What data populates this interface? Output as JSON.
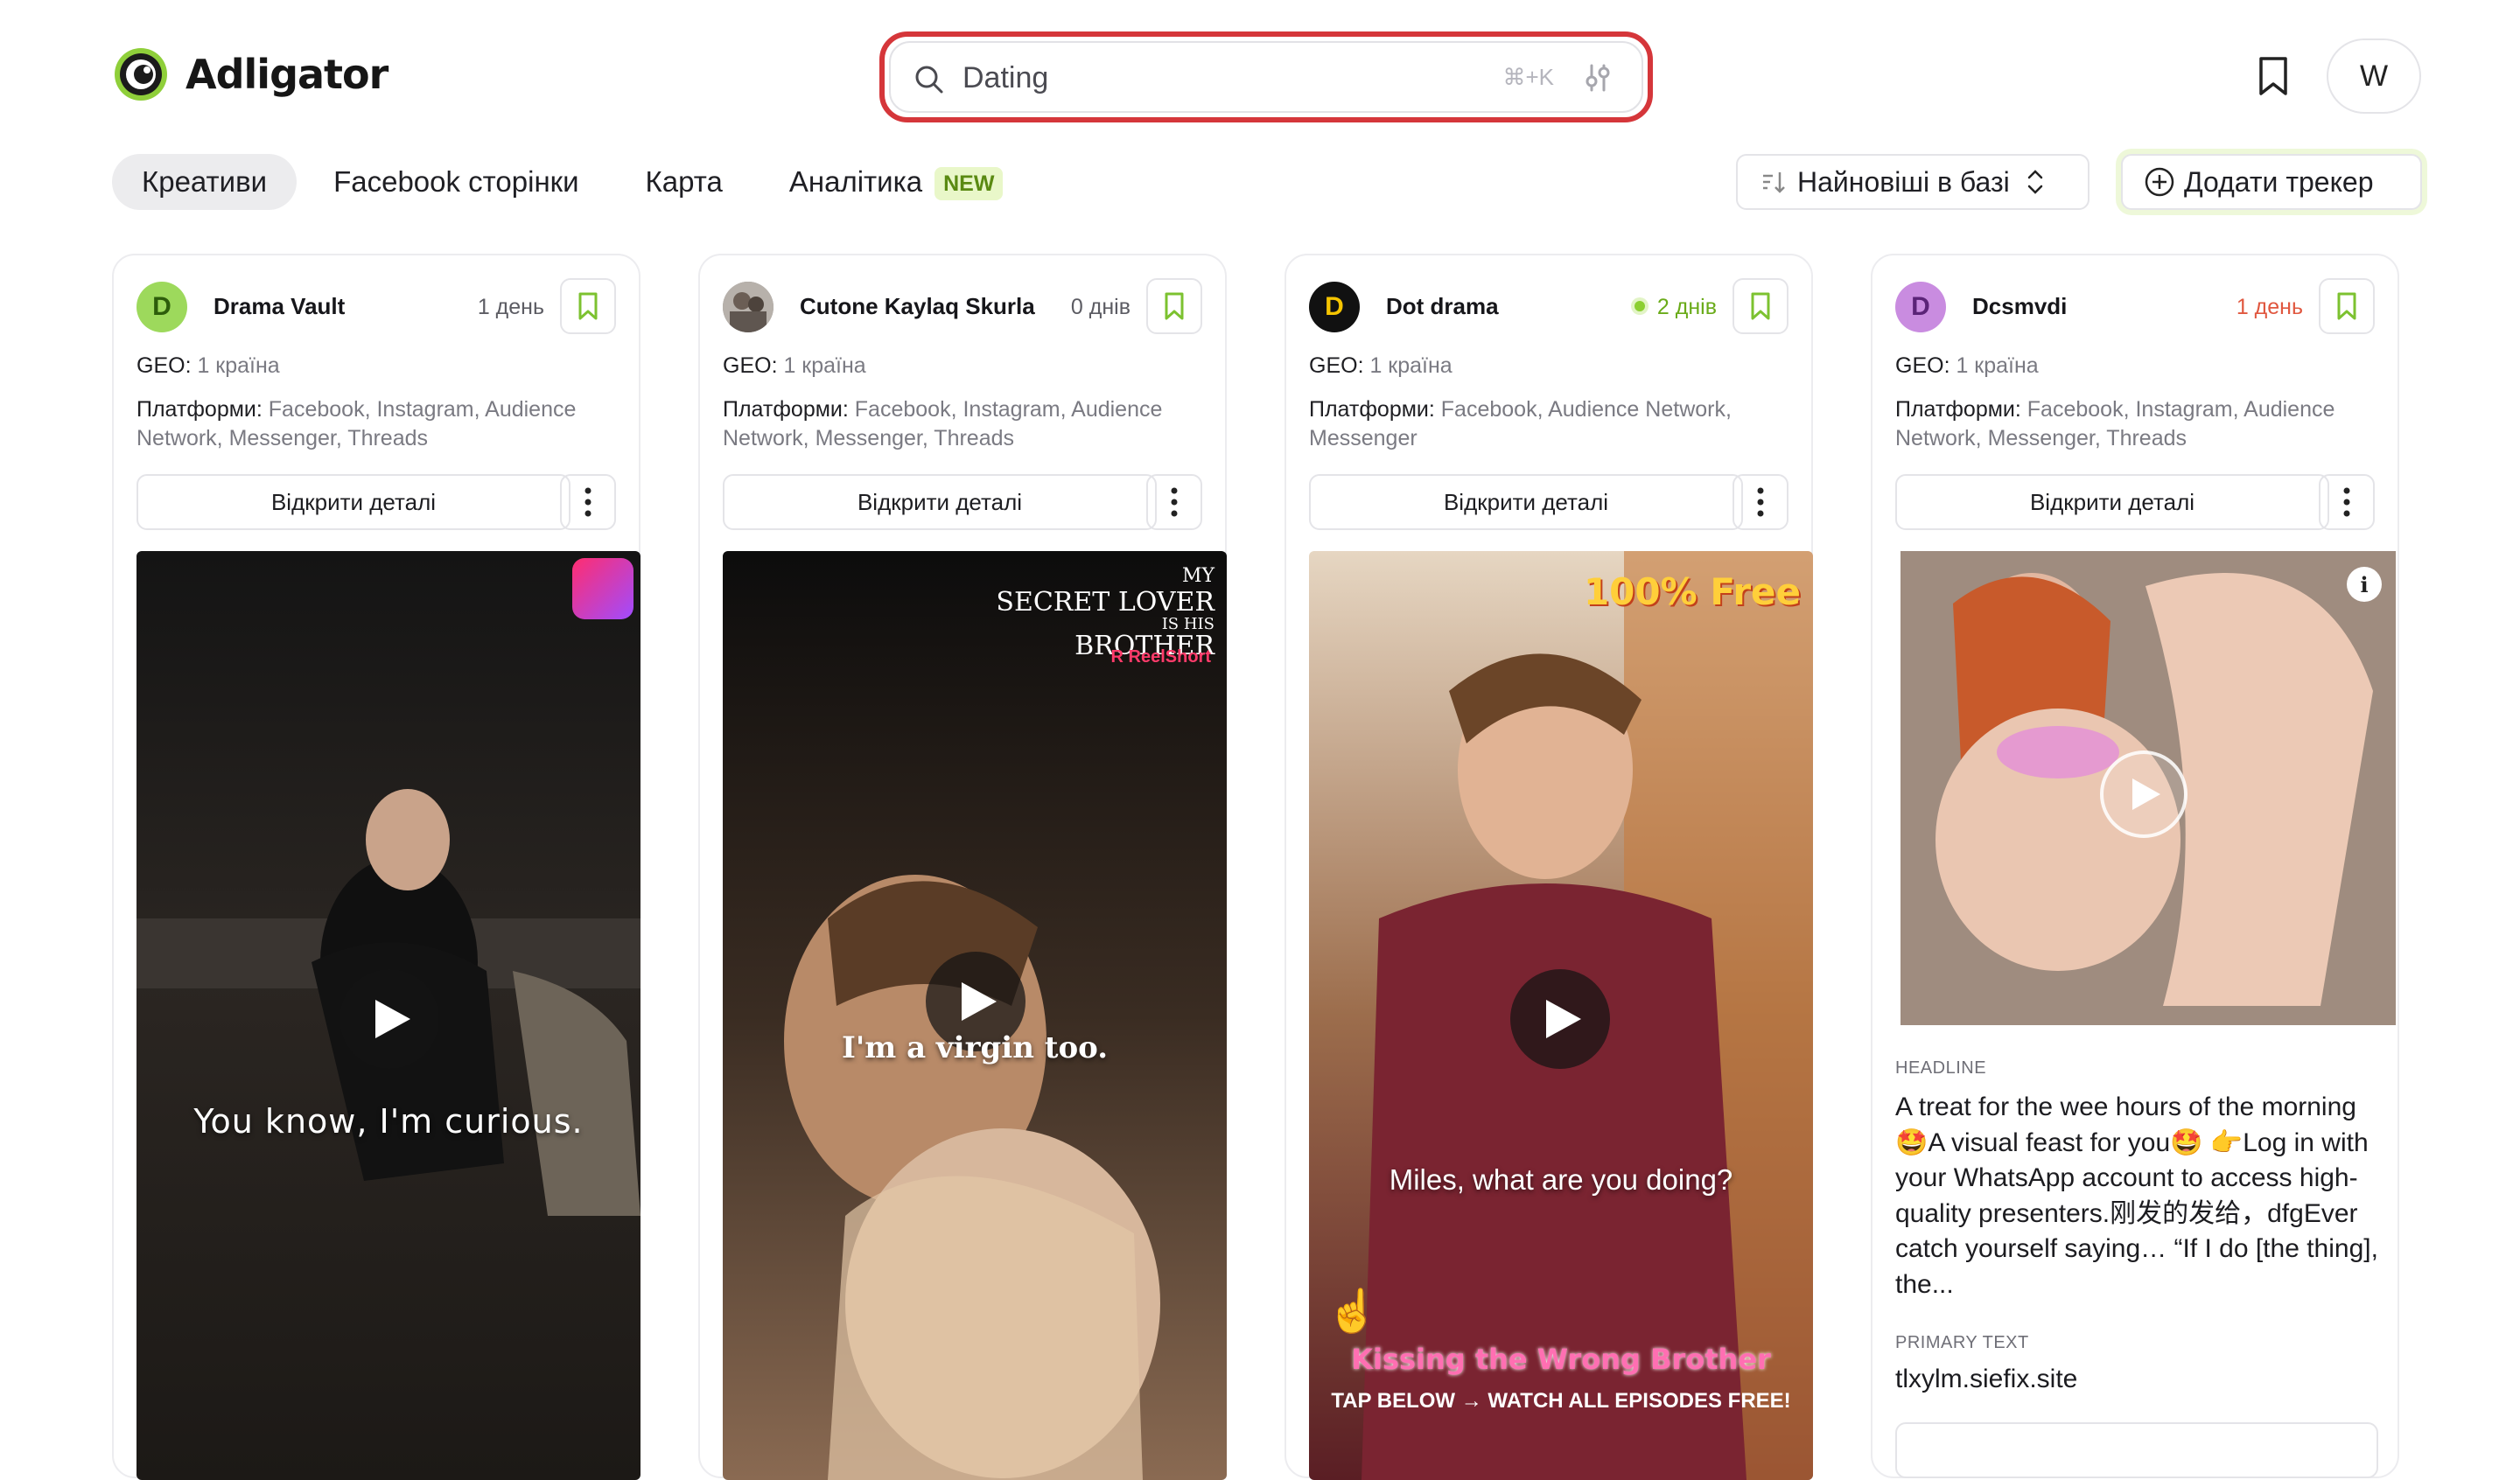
{
  "app": {
    "name": "Adligator"
  },
  "search": {
    "value": "Dating",
    "shortcut": "⌘+K"
  },
  "header": {
    "avatar_letter": "W"
  },
  "nav": {
    "tabs": [
      "Креативи",
      "Facebook сторінки",
      "Карта",
      "Аналітика"
    ],
    "new_badge": "NEW",
    "sort_label": "Найновіші в базі",
    "add_tracker": "Додати трекер"
  },
  "colors": {
    "accent_ring": "#d5363a",
    "new_badge_bg": "#e9f7c9",
    "age_green": "#6aab19",
    "age_red": "#e0573f"
  },
  "cards": [
    {
      "avatar_letter": "D",
      "name": "Drama Vault",
      "age": "1 день",
      "geo_label": "GEO:",
      "geo_value": " 1 країна",
      "platforms_label": "Платформи:",
      "platforms_value": " Facebook, Instagram, Audience Network, Messenger, Threads",
      "details_label": "Відкрити деталі",
      "caption": "You know, I'm curious."
    },
    {
      "avatar_letter": "",
      "name": "Cutone Kaylaq Skurla",
      "age": "0 днів",
      "geo_label": "GEO:",
      "geo_value": " 1 країна",
      "platforms_label": "Платформи:",
      "platforms_value": " Facebook, Instagram, Audience Network, Messenger, Threads",
      "details_label": "Відкрити деталі",
      "caption": "I'm a virgin too.",
      "overlay_title_1": "MY",
      "overlay_title_2": "SECRET LOVER",
      "overlay_title_3": "IS HIS",
      "overlay_title_4": "BROTHER",
      "overlay_brand": "R ReelShort"
    },
    {
      "avatar_letter": "D",
      "name": "Dot drama",
      "age": "2 днів",
      "geo_label": "GEO:",
      "geo_value": " 1 країна",
      "platforms_label": "Платформи:",
      "platforms_value": " Facebook, Audience Network, Messenger",
      "details_label": "Відкрити деталі",
      "caption": "Miles, what are you doing?",
      "free_tag": "100% Free",
      "pink_title": "Kissing the Wrong Brother",
      "tap_text": "TAP BELOW → WATCH ALL EPISODES FREE!"
    },
    {
      "avatar_letter": "D",
      "name": "Dcsmvdi",
      "age": "1 день",
      "geo_label": "GEO:",
      "geo_value": " 1 країна",
      "platforms_label": "Платформи:",
      "platforms_value": " Facebook, Instagram, Audience Network, Messenger, Threads",
      "details_label": "Відкрити деталі",
      "info": "i",
      "headline_label": "HEADLINE",
      "headline": "A treat for the wee hours of the morning 🤩A visual feast for you🤩 👉Log in with your WhatsApp account to access high-quality presenters.刚发的发给，dfgEver catch yourself saying… “If I do [the thing], the...",
      "primary_label": "PRIMARY TEXT",
      "primary_text": "tlxylm.siefix.site"
    }
  ]
}
